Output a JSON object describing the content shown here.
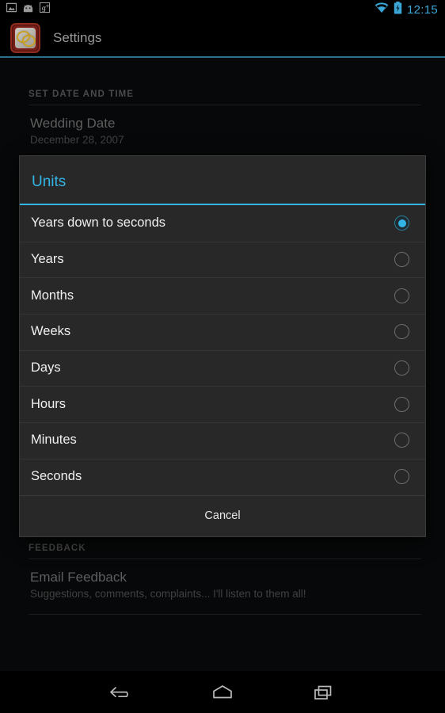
{
  "status_bar": {
    "icons": [
      "photo-icon",
      "android-robot-icon",
      "google-plus-icon"
    ],
    "wifi_icon": "wifi-icon",
    "battery_icon": "battery-charging-icon",
    "clock": "12:15",
    "accent": "#3ba7d6"
  },
  "action_bar": {
    "app_icon": "wedding-rings-app-icon",
    "title": "Settings",
    "underline_color": "#2c6f8e"
  },
  "page": {
    "sections": [
      {
        "header": "SET DATE AND TIME",
        "items": [
          {
            "title": "Wedding Date",
            "subtitle": "December 28, 2007"
          }
        ]
      },
      {
        "header": "FEEDBACK",
        "items": [
          {
            "title": "Email Feedback",
            "subtitle": "Suggestions, comments, complaints... I'll listen to them all!"
          }
        ]
      }
    ]
  },
  "dialog": {
    "title": "Units",
    "accent": "#33b5e5",
    "options": [
      {
        "label": "Years down to seconds",
        "selected": true
      },
      {
        "label": "Years",
        "selected": false
      },
      {
        "label": "Months",
        "selected": false
      },
      {
        "label": "Weeks",
        "selected": false
      },
      {
        "label": "Days",
        "selected": false
      },
      {
        "label": "Hours",
        "selected": false
      },
      {
        "label": "Minutes",
        "selected": false
      },
      {
        "label": "Seconds",
        "selected": false
      }
    ],
    "cancel_label": "Cancel"
  },
  "nav_bar": {
    "buttons": [
      {
        "name": "back-icon"
      },
      {
        "name": "home-icon"
      },
      {
        "name": "recents-icon"
      }
    ]
  }
}
